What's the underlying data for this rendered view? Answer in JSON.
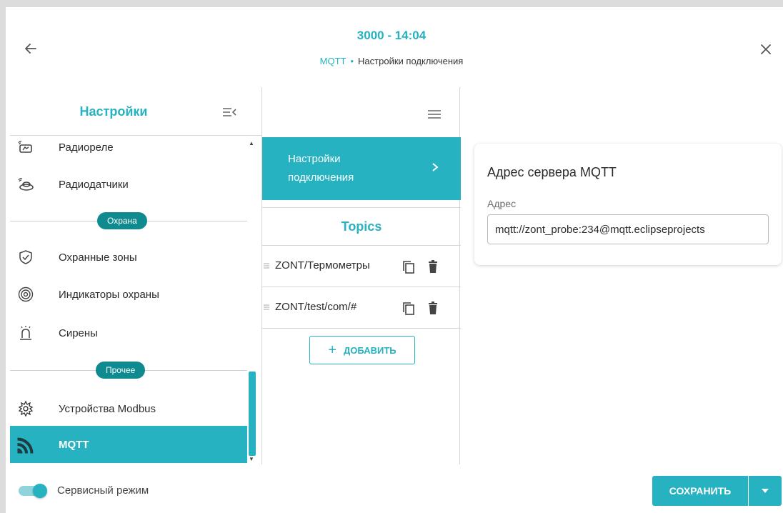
{
  "header": {
    "title": "3000 - 14:04",
    "breadcrumb": [
      "MQTT",
      "Настройки подключения"
    ],
    "breadcrumb_sep": "•"
  },
  "sidebar": {
    "title": "Настройки",
    "items_top": [
      {
        "label": "Радиореле",
        "icon": "radio-relay-icon"
      },
      {
        "label": "Радиодатчики",
        "icon": "radio-sensor-icon"
      }
    ],
    "section_guard": "Охрана",
    "items_guard": [
      {
        "label": "Охранные зоны",
        "icon": "shield-check-icon"
      },
      {
        "label": "Индикаторы охраны",
        "icon": "guard-indicator-icon"
      },
      {
        "label": "Сирены",
        "icon": "siren-icon"
      }
    ],
    "section_other": "Прочее",
    "items_other": [
      {
        "label": "Устройства Modbus",
        "icon": "modbus-icon"
      },
      {
        "label": "MQTT",
        "icon": "rss-icon",
        "active": true
      }
    ]
  },
  "middle": {
    "active_item": "Настройки подключения",
    "topics_title": "Topics",
    "topics": [
      "ZONT/Термометры",
      "ZONT/test/com/#"
    ],
    "add_label": "ДОБАВИТЬ"
  },
  "card": {
    "title": "Адрес сервера MQTT",
    "field_label": "Адрес",
    "field_value": "mqtt://zont_probe:234@mqtt.eclipseprojects"
  },
  "footer": {
    "service_mode_label": "Сервисный режим",
    "service_mode_on": true,
    "save_label": "СОХРАНИТЬ"
  },
  "colors": {
    "accent": "#26b2c0",
    "chip": "#0f8b8f"
  }
}
